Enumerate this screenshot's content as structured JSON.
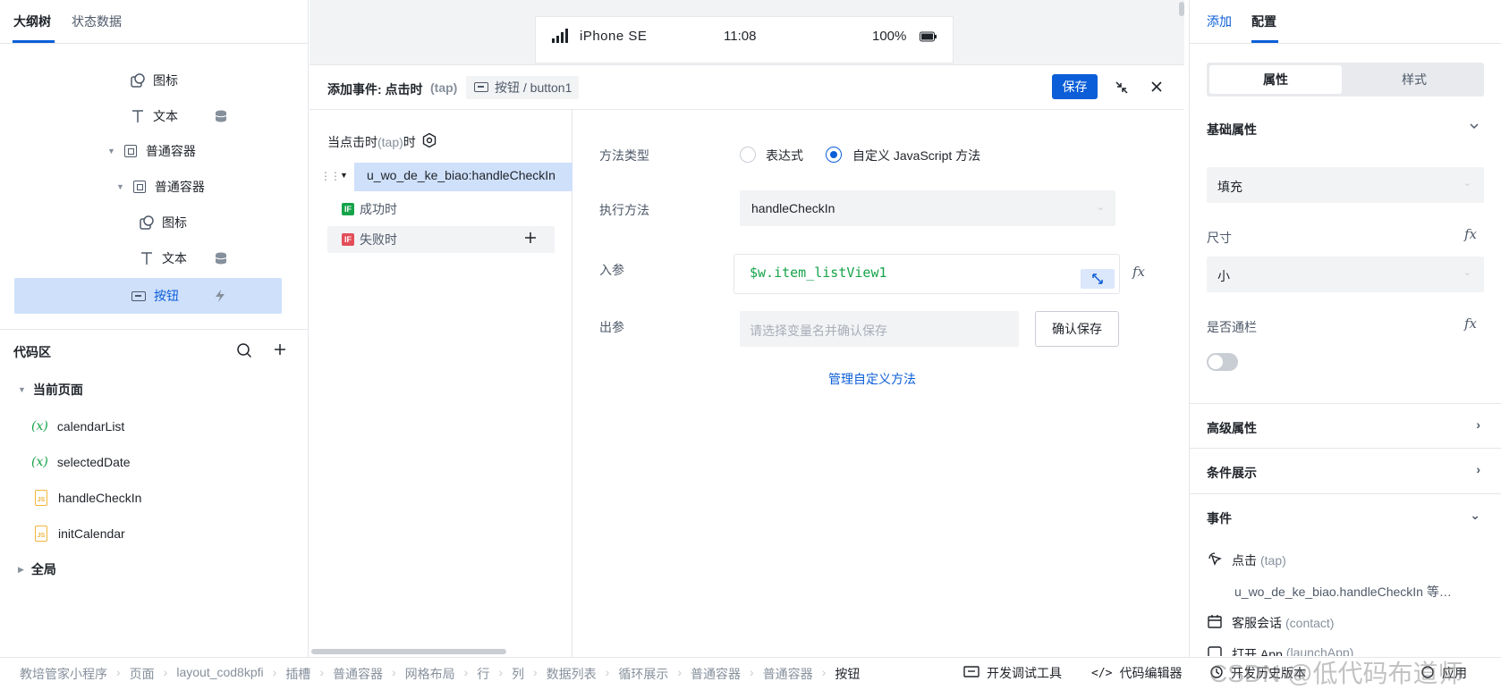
{
  "left": {
    "tabs": [
      "大纲树",
      "状态数据"
    ],
    "tree": [
      {
        "label": "图标"
      },
      {
        "label": "文本"
      },
      {
        "label": "普通容器"
      },
      {
        "label": "普通容器"
      },
      {
        "label": "图标"
      },
      {
        "label": "文本"
      },
      {
        "label": "按钮"
      }
    ],
    "code": {
      "title": "代码区",
      "current_page": "当前页面",
      "items": [
        "calendarList",
        "selectedDate",
        "handleCheckIn",
        "initCalendar"
      ],
      "global": "全局"
    }
  },
  "phone": {
    "carrier": "iPhone SE",
    "time": "11:08",
    "battery": "100%"
  },
  "event": {
    "title": "添加事件: 点击时",
    "title_tap": "(tap)",
    "target": "按钮 / button1",
    "save": "保存",
    "trigger_prefix": "当点击时",
    "trigger_tap": "(tap)",
    "trigger_suffix": "时",
    "action": "u_wo_de_ke_biao:handleCheckIn",
    "success": "成功时",
    "fail": "失败时",
    "if_badge": "IF",
    "method_type_label": "方法类型",
    "radio_expr": "表达式",
    "radio_custom": "自定义 JavaScript 方法",
    "exec_label": "执行方法",
    "exec_value": "handleCheckIn",
    "in_label": "入参",
    "in_value": "$w.item_listView1",
    "out_label": "出参",
    "out_placeholder": "请选择变量名并确认保存",
    "confirm": "确认保存",
    "manage": "管理自定义方法"
  },
  "right": {
    "tabs": [
      "添加",
      "配置"
    ],
    "seg": [
      "属性",
      "样式"
    ],
    "basic": "基础属性",
    "fill_value": "填充",
    "size_label": "尺寸",
    "size_value": "小",
    "banner_label": "是否通栏",
    "advanced": "高级属性",
    "condition": "条件展示",
    "events": "事件",
    "ev_click": "点击",
    "ev_click_tap": "(tap)",
    "ev_click_detail": "u_wo_de_ke_biao.handleCheckIn 等…",
    "ev_contact": "客服会话",
    "ev_contact_tap": "(contact)",
    "ev_launch": "打开 App",
    "ev_launch_tap": "(launchApp)"
  },
  "breadcrumb": [
    "教培管家小程序",
    "页面",
    "layout_cod8kpfi",
    "插槽",
    "普通容器",
    "网格布局",
    "行",
    "列",
    "数据列表",
    "循环展示",
    "普通容器",
    "普通容器",
    "按钮"
  ],
  "bottom_tools": [
    "开发调试工具",
    "代码编辑器",
    "开发历史版本",
    "应用"
  ],
  "watermark": "CSDN @低代码布道师"
}
